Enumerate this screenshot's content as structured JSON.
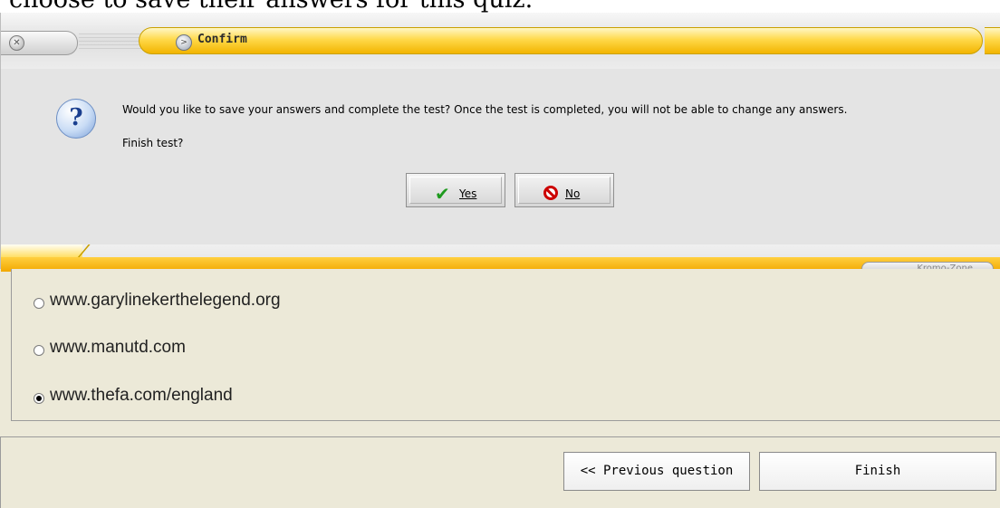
{
  "doc_fragment": "choose to save their answers for this quiz.",
  "dialog": {
    "title": "Confirm",
    "message": "Would you like to save your answers and complete the test?  Once the test is completed, you will not be able to change any answers.",
    "question": "Finish test?",
    "yes_label": "Yes",
    "no_label": "No",
    "skin_label": "Kromo-Zone"
  },
  "quiz": {
    "options": [
      {
        "label": "www.garylinekerthelegend.org",
        "selected": false
      },
      {
        "label": "www.manutd.com",
        "selected": false
      },
      {
        "label": "www.thefa.com/england",
        "selected": true
      }
    ]
  },
  "footer": {
    "previous_label": "<< Previous question",
    "finish_label": "Finish"
  },
  "colors": {
    "accent_yellow": "#ffd94a",
    "accent_orange": "#f2a800",
    "check_green": "#1e9a1e",
    "cancel_red": "#cc0000"
  }
}
